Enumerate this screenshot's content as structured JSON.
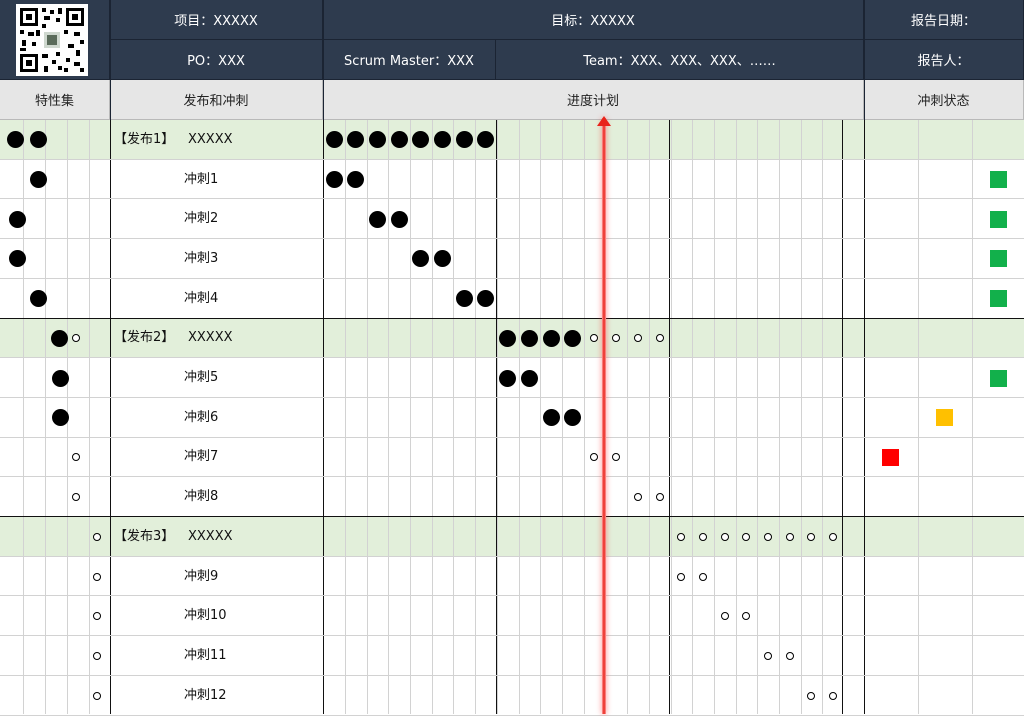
{
  "header": {
    "project_label": "项目：XXXXX",
    "goal_label": "目标：XXXXX",
    "report_date_label": "报告日期：",
    "po_label": "PO：XXX",
    "scrum_master_label": "Scrum Master：XXX",
    "team_label": "Team：XXX、XXX、XXX、……",
    "reporter_label": "报告人："
  },
  "columns": {
    "feature_set": "特性集",
    "release_sprint": "发布和冲刺",
    "progress_plan": "进度计划",
    "sprint_status": "冲刺状态"
  },
  "rows": [
    {
      "tag": "【发布1】",
      "name": "XXXXX",
      "type": "release"
    },
    {
      "tag": "",
      "name": "冲刺1",
      "type": "sprint",
      "status": "green"
    },
    {
      "tag": "",
      "name": "冲刺2",
      "type": "sprint",
      "status": "green"
    },
    {
      "tag": "",
      "name": "冲刺3",
      "type": "sprint",
      "status": "green"
    },
    {
      "tag": "",
      "name": "冲刺4",
      "type": "sprint",
      "status": "green"
    },
    {
      "tag": "【发布2】",
      "name": "XXXXX",
      "type": "release"
    },
    {
      "tag": "",
      "name": "冲刺5",
      "type": "sprint",
      "status": "green"
    },
    {
      "tag": "",
      "name": "冲刺6",
      "type": "sprint",
      "status": "yellow"
    },
    {
      "tag": "",
      "name": "冲刺7",
      "type": "sprint",
      "status": "red"
    },
    {
      "tag": "",
      "name": "冲刺8",
      "type": "sprint",
      "status": ""
    },
    {
      "tag": "【发布3】",
      "name": "XXXXX",
      "type": "release"
    },
    {
      "tag": "",
      "name": "冲刺9",
      "type": "sprint",
      "status": ""
    },
    {
      "tag": "",
      "name": "冲刺10",
      "type": "sprint",
      "status": ""
    },
    {
      "tag": "",
      "name": "冲刺11",
      "type": "sprint",
      "status": ""
    },
    {
      "tag": "",
      "name": "冲刺12",
      "type": "sprint",
      "status": ""
    }
  ],
  "status_colors": {
    "green": "#12b04b",
    "yellow": "#ffc000",
    "red": "#ff0000"
  },
  "legend_icons": {
    "done": "filled-circle",
    "planned": "open-circle"
  }
}
